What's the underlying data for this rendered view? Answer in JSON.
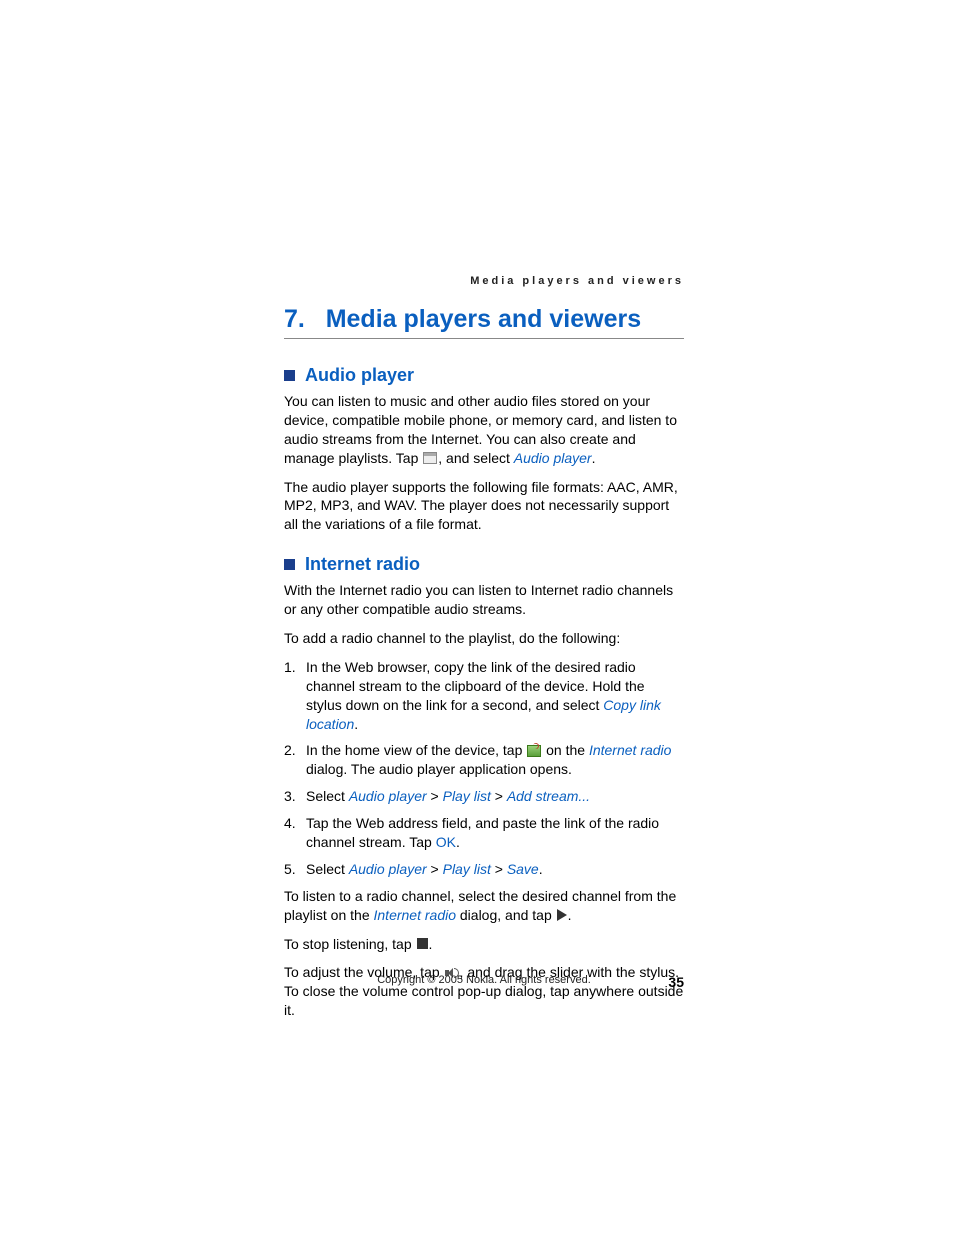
{
  "running_head": "Media players and viewers",
  "chapter": {
    "num": "7.",
    "title": "Media players and viewers"
  },
  "sec1": {
    "title": "Audio player",
    "p1a": "You can listen to music and other audio files stored on your device, compatible mobile phone, or memory card, and listen to audio streams from the Internet. You can also create and manage playlists. Tap ",
    "p1b": ", and select ",
    "link_audio": "Audio player",
    "p1c": ".",
    "p2": "The audio player supports the following file formats: AAC, AMR, MP2, MP3, and WAV. The player does not necessarily support all the variations of a file format."
  },
  "sec2": {
    "title": "Internet radio",
    "p1": "With the Internet radio you can listen to Internet radio channels or any other compatible audio streams.",
    "p2": "To add a radio channel to the playlist, do the following:",
    "steps": [
      {
        "n": "1.",
        "a": "In the Web browser, copy the link of the desired radio channel stream to the clipboard of the device. Hold the stylus down on the link for a second, and select ",
        "link": "Copy link location",
        "b": "."
      },
      {
        "n": "2.",
        "a": "In the home view of the device, tap ",
        "icon": "radio",
        "mid": " on the ",
        "link": "Internet radio",
        "b": " dialog. The audio player application opens."
      },
      {
        "n": "3.",
        "a": "Select ",
        "links": [
          "Audio player",
          "Play list",
          "Add stream..."
        ]
      },
      {
        "n": "4.",
        "a": "Tap the Web address field, and paste the link of the radio channel stream. Tap ",
        "ok": "OK",
        "b": "."
      },
      {
        "n": "5.",
        "a": "Select ",
        "links": [
          "Audio player",
          "Play list",
          "Save"
        ],
        "b": "."
      }
    ],
    "p3a": "To listen to a radio channel, select the desired channel from the playlist on the ",
    "p3_link": "Internet radio",
    "p3b": " dialog, and tap ",
    "p3c": ".",
    "p4a": "To stop listening, tap ",
    "p4b": ".",
    "p5a": "To adjust the volume, tap ",
    "p5b": ", and drag the slider with the stylus. To close the volume control pop-up dialog, tap anywhere outside it."
  },
  "footer": {
    "copyright": "Copyright © 2005 Nokia. All rights reserved.",
    "page": "35"
  },
  "sep": " > "
}
